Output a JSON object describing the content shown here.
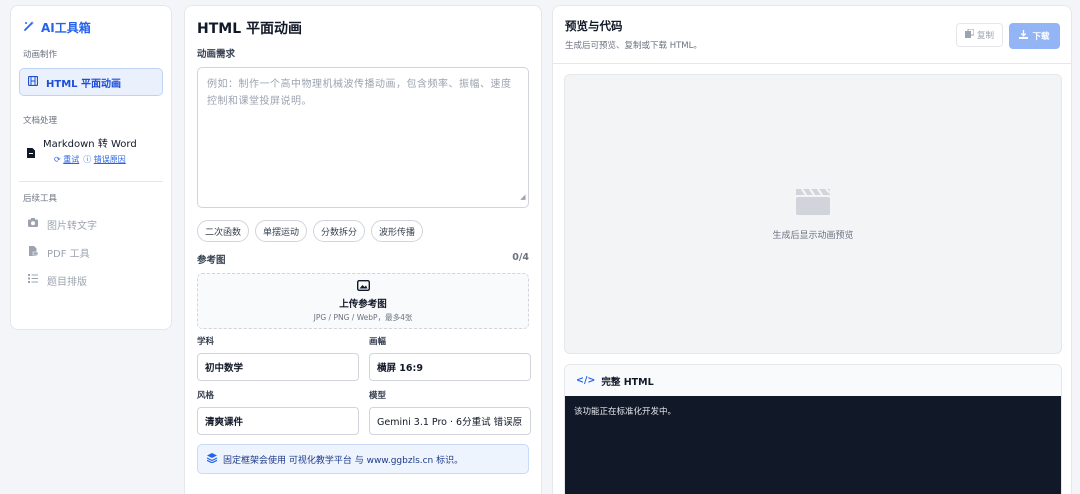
{
  "sidebar": {
    "brand": "AI工具箱",
    "section_animation": "动画制作",
    "active_item": "HTML 平面动画",
    "section_docs": "文档处理",
    "md_item": {
      "label": "Markdown 转 Word",
      "retry": "重试",
      "error_reason": "错误原因"
    },
    "section_later": "后续工具",
    "later_items": [
      "图片转文字",
      "PDF 工具",
      "题目排版"
    ]
  },
  "form": {
    "title": "HTML 平面动画",
    "requirement_label": "动画需求",
    "requirement_placeholder": "例如：制作一个高中物理机械波传播动画，包含频率、振幅、速度控制和课堂投屏说明。",
    "chips": [
      "二次函数",
      "单摆运动",
      "分数拆分",
      "波形传播"
    ],
    "ref_label": "参考图",
    "ref_count": "0/4",
    "upload_title": "上传参考图",
    "upload_hint": "JPG / PNG / WebP，最多4张",
    "subject_label": "学科",
    "subject_value": "初中数学",
    "ratio_label": "画幅",
    "ratio_value": "横屏 16:9",
    "style_label": "风格",
    "style_value": "清爽课件",
    "model_label": "模型",
    "model_value": "Gemini 3.1 Pro · 6分重试 错误原",
    "notice": "固定框架会使用 可视化教学平台 与 www.ggbzls.cn 标识。"
  },
  "preview": {
    "title": "预览与代码",
    "subtitle": "生成后可预览、复制或下载 HTML。",
    "copy_label": "复制",
    "download_label": "下载",
    "placeholder_text": "生成后显示动画预览",
    "code_title": "完整 HTML",
    "code_text": "该功能正在标准化开发中。"
  },
  "colors": {
    "accent": "#2563eb",
    "active_bg": "#eaf1fd",
    "download_bg": "#93b5f5",
    "code_bg": "#111827"
  },
  "icons": {
    "brand": "magic-wand-icon",
    "active": "film-icon",
    "doc": "word-file-icon",
    "later": [
      "camera-icon",
      "pdf-file-icon",
      "list-icon"
    ],
    "upload": "image-icon",
    "notice": "layers-icon",
    "copy": "copy-icon",
    "download": "download-icon",
    "stage": "clapperboard-icon",
    "code": "code-icon"
  }
}
